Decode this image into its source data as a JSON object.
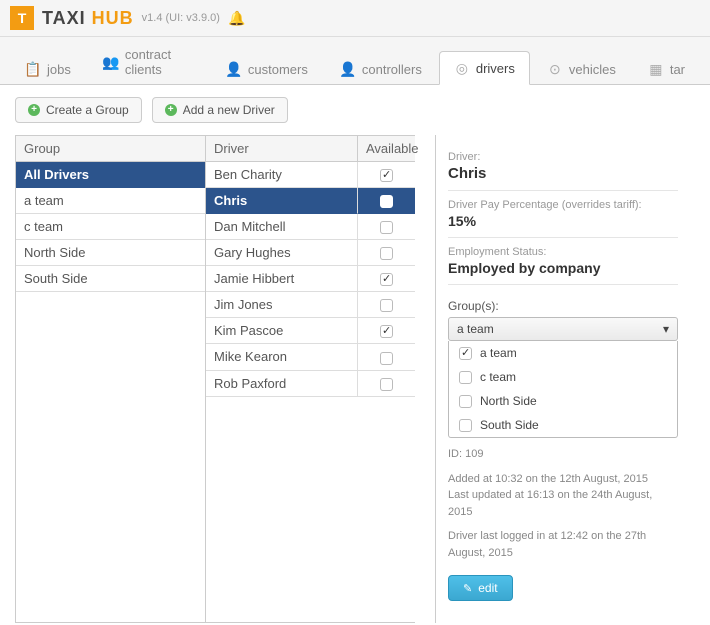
{
  "header": {
    "brand1": "TAXI ",
    "brand2": "HUB",
    "version": "v1.4  (UI: v3.9.0)"
  },
  "tabs": {
    "jobs": "jobs",
    "contract": "contract clients",
    "customers": "customers",
    "controllers": "controllers",
    "drivers": "drivers",
    "vehicles": "vehicles",
    "tariffs": "tar"
  },
  "toolbar": {
    "create_group": "Create a Group",
    "add_driver": "Add a new Driver"
  },
  "group_header": "Group",
  "driver_header": "Driver",
  "available_header": "Available",
  "groups": [
    {
      "name": "All Drivers",
      "selected": true
    },
    {
      "name": "a team"
    },
    {
      "name": "c team"
    },
    {
      "name": "North Side"
    },
    {
      "name": "South Side"
    }
  ],
  "drivers": [
    {
      "name": "Ben Charity",
      "available": true
    },
    {
      "name": "Chris",
      "available": false,
      "selected": true
    },
    {
      "name": "Dan Mitchell",
      "available": false
    },
    {
      "name": "Gary Hughes",
      "available": false
    },
    {
      "name": "Jamie Hibbert",
      "available": true
    },
    {
      "name": "Jim Jones",
      "available": false
    },
    {
      "name": "Kim Pascoe",
      "available": true
    },
    {
      "name": "Mike Kearon",
      "available": false
    },
    {
      "name": "Rob Paxford",
      "available": false
    }
  ],
  "details": {
    "driver_label": "Driver:",
    "driver_name": "Chris",
    "pay_label": "Driver Pay Percentage (overrides tariff):",
    "pay_value": "15%",
    "emp_label": "Employment Status:",
    "emp_value": "Employed by company",
    "groups_label": "Group(s):",
    "group_selected": "a team",
    "group_options": [
      {
        "label": "a team",
        "checked": true
      },
      {
        "label": "c team",
        "checked": false
      },
      {
        "label": "North Side",
        "checked": false
      },
      {
        "label": "South Side",
        "checked": false
      }
    ],
    "id_line": "ID: 109",
    "added": "Added at 10:32 on the 12th August, 2015",
    "updated": "Last updated at 16:13 on the 24th August, 2015",
    "login": "Driver last logged in at 12:42 on the 27th August, 2015",
    "edit_label": "edit"
  }
}
